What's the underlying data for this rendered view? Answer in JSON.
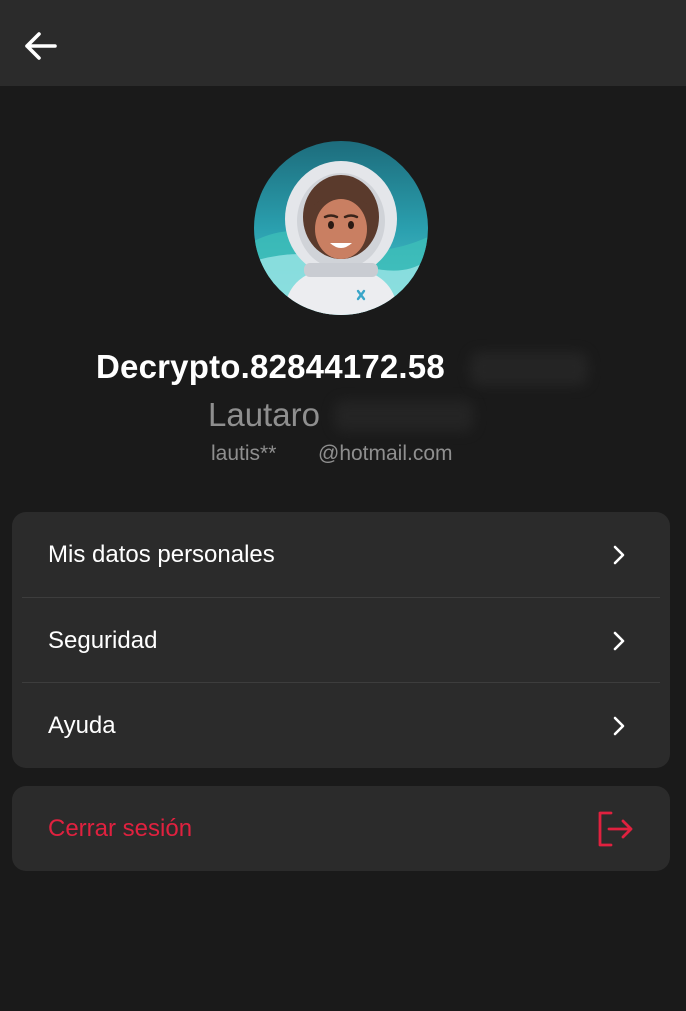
{
  "header": {
    "back_icon": "arrow-left-icon"
  },
  "profile": {
    "username": "Decrypto.82844172.58",
    "name": "Lautaro",
    "email_user": "lautis**",
    "email_domain": "@hotmail.com",
    "avatar_icon": "astronaut-avatar"
  },
  "menu": {
    "items": [
      {
        "label": "Mis datos personales",
        "icon": "chevron-right-icon"
      },
      {
        "label": "Seguridad",
        "icon": "chevron-right-icon"
      },
      {
        "label": "Ayuda",
        "icon": "chevron-right-icon"
      }
    ]
  },
  "logout": {
    "label": "Cerrar sesión",
    "icon": "logout-icon"
  },
  "colors": {
    "background": "#1a1a1a",
    "card": "#2b2b2b",
    "logout_accent": "#e0213f",
    "muted_text": "#8f8f8f"
  }
}
